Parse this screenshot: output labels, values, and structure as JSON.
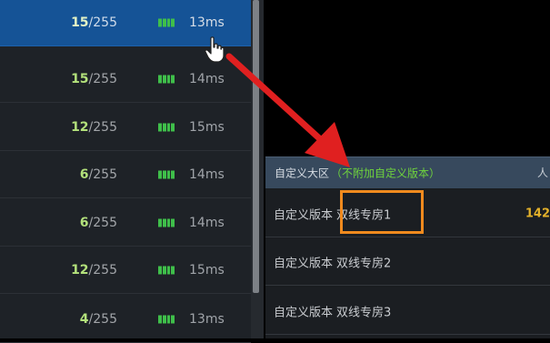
{
  "server_list": {
    "rows": [
      {
        "current": "15",
        "max": "/255",
        "ping": "13ms",
        "selected": true
      },
      {
        "current": "15",
        "max": "/255",
        "ping": "14ms",
        "selected": false
      },
      {
        "current": "12",
        "max": "/255",
        "ping": "15ms",
        "selected": false
      },
      {
        "current": "6",
        "max": "/255",
        "ping": "14ms",
        "selected": false
      },
      {
        "current": "6",
        "max": "/255",
        "ping": "14ms",
        "selected": false
      },
      {
        "current": "12",
        "max": "/255",
        "ping": "15ms",
        "selected": false
      },
      {
        "current": "4",
        "max": "/255",
        "ping": "13ms",
        "selected": false
      }
    ]
  },
  "region": {
    "title": "自定义大区",
    "note": "（不附加自定义版本）",
    "edge_text": "人"
  },
  "rooms": [
    {
      "label": "自定义版本",
      "room": "双线专房1",
      "count": "142"
    },
    {
      "label": "自定义版本",
      "room": "双线专房2",
      "count": ""
    },
    {
      "label": "自定义版本",
      "room": "双线专房3",
      "count": ""
    }
  ],
  "colors": {
    "selected_row": "#155396",
    "player_count": "#b3e17b",
    "signal_bars": "#3fbf4a",
    "header_note": "#6fd43d",
    "highlight": "#f08a1e",
    "arrow": "#e02020",
    "count": "#e3b12a"
  },
  "icons": {
    "cursor": "hand-pointer-icon",
    "signal": "signal-bars-icon",
    "arrow": "red-arrow-annotation"
  }
}
